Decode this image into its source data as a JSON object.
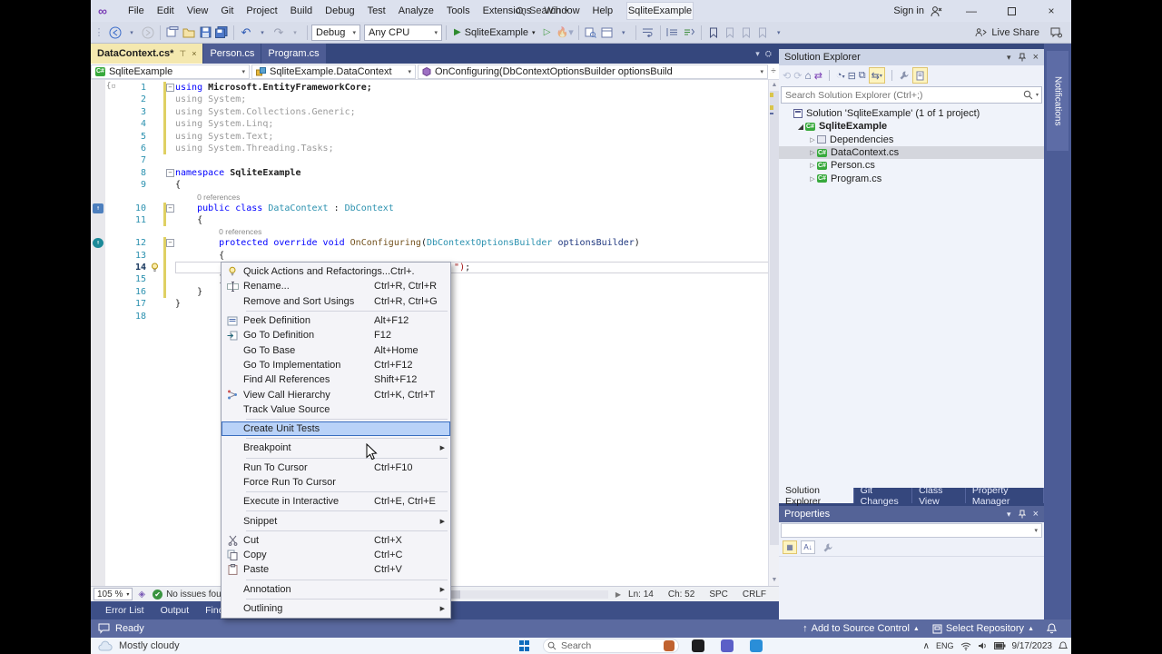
{
  "window": {
    "title_pill": "SqliteExample",
    "sign_in": "Sign in",
    "live_share": "Live Share"
  },
  "menubar": {
    "items": [
      "File",
      "Edit",
      "View",
      "Git",
      "Project",
      "Build",
      "Debug",
      "Test",
      "Analyze",
      "Tools",
      "Extensions",
      "Window",
      "Help"
    ],
    "search_label": "Search"
  },
  "toolbar": {
    "debug_config": "Debug",
    "platform": "Any CPU",
    "run_target": "SqliteExample"
  },
  "doc_tabs": [
    {
      "label": "DataContext.cs*",
      "active": true
    },
    {
      "label": "Person.cs",
      "active": false
    },
    {
      "label": "Program.cs",
      "active": false
    }
  ],
  "navbar": {
    "project": "SqliteExample",
    "type": "SqliteExample.DataContext",
    "member": "OnConfiguring(DbContextOptionsBuilder optionsBuild"
  },
  "editor": {
    "codelens_text": "0 references",
    "lines": [
      {
        "n": 1,
        "bar": true,
        "fold": true,
        "segs": [
          [
            "kw",
            "using"
          ],
          [
            "bd",
            " Microsoft.EntityFrameworkCore;"
          ]
        ]
      },
      {
        "n": 2,
        "bar": true,
        "segs": [
          [
            "gr",
            "using System;"
          ]
        ]
      },
      {
        "n": 3,
        "bar": true,
        "segs": [
          [
            "gr",
            "using System.Collections.Generic;"
          ]
        ]
      },
      {
        "n": 4,
        "bar": true,
        "segs": [
          [
            "gr",
            "using System.Linq;"
          ]
        ]
      },
      {
        "n": 5,
        "bar": true,
        "segs": [
          [
            "gr",
            "using System.Text;"
          ]
        ]
      },
      {
        "n": 6,
        "bar": true,
        "segs": [
          [
            "gr",
            "using System.Threading.Tasks;"
          ]
        ]
      },
      {
        "n": 7,
        "segs": []
      },
      {
        "n": 8,
        "fold": true,
        "segs": [
          [
            "kw",
            "namespace"
          ],
          [
            "bd",
            " SqliteExample"
          ]
        ]
      },
      {
        "n": 9,
        "segs": [
          [
            "pl",
            "{"
          ]
        ]
      },
      {
        "n": 10,
        "lens": true,
        "lenspad": 4,
        "bar": true,
        "fold": true,
        "micon": "cls",
        "segs": [
          [
            "kw",
            "    public class"
          ],
          [
            "ty",
            " DataContext"
          ],
          [
            "pl",
            " : "
          ],
          [
            "ty",
            "DbContext"
          ]
        ]
      },
      {
        "n": 11,
        "bar": true,
        "segs": [
          [
            "pl",
            "    {"
          ]
        ]
      },
      {
        "n": 12,
        "lens": true,
        "lenspad": 8,
        "bar": true,
        "fold": true,
        "micon": "mth",
        "segs": [
          [
            "kw",
            "        protected override void"
          ],
          [
            "me",
            " OnConfiguring"
          ],
          [
            "pl",
            "("
          ],
          [
            "ty",
            "DbContextOptionsBuilder"
          ],
          [
            "pa",
            " optionsBuilder"
          ],
          [
            "pl",
            ")"
          ]
        ]
      },
      {
        "n": 13,
        "bar": true,
        "segs": [
          [
            "pl",
            "        {"
          ]
        ]
      },
      {
        "n": 14,
        "bar": true,
        "caret": true,
        "bulb": true,
        "segs": [
          [
            "pl",
            "                                                   "
          ],
          [
            "st",
            "\")"
          ],
          [
            "pl",
            ";"
          ]
        ]
      },
      {
        "n": 15,
        "bar": true,
        "segs": [
          [
            "pl",
            "        }"
          ]
        ]
      },
      {
        "n": 16,
        "bar": true,
        "segs": [
          [
            "pl",
            "    }"
          ]
        ]
      },
      {
        "n": 17,
        "segs": [
          [
            "pl",
            "}"
          ]
        ]
      },
      {
        "n": 18,
        "segs": []
      }
    ]
  },
  "context_menu": {
    "items": [
      {
        "icon": "bulb",
        "label": "Quick Actions and Refactorings...",
        "shortcut": "Ctrl+."
      },
      {
        "icon": "rename",
        "label": "Rename...",
        "shortcut": "Ctrl+R, Ctrl+R"
      },
      {
        "label": "Remove and Sort Usings",
        "shortcut": "Ctrl+R, Ctrl+G",
        "sep": true
      },
      {
        "icon": "peek",
        "label": "Peek Definition",
        "shortcut": "Alt+F12"
      },
      {
        "icon": "goto",
        "label": "Go To Definition",
        "shortcut": "F12"
      },
      {
        "label": "Go To Base",
        "shortcut": "Alt+Home"
      },
      {
        "label": "Go To Implementation",
        "shortcut": "Ctrl+F12"
      },
      {
        "label": "Find All References",
        "shortcut": "Shift+F12"
      },
      {
        "icon": "hier",
        "label": "View Call Hierarchy",
        "shortcut": "Ctrl+K, Ctrl+T"
      },
      {
        "label": "Track Value Source",
        "sep": true
      },
      {
        "label": "Create Unit Tests",
        "highlighted": true,
        "sep": true
      },
      {
        "label": "Breakpoint",
        "submenu": true,
        "sep": true
      },
      {
        "label": "Run To Cursor",
        "shortcut": "Ctrl+F10"
      },
      {
        "label": "Force Run To Cursor",
        "sep": true
      },
      {
        "label": "Execute in Interactive",
        "shortcut": "Ctrl+E, Ctrl+E",
        "sep": true
      },
      {
        "label": "Snippet",
        "submenu": true,
        "sep": true
      },
      {
        "icon": "cut",
        "label": "Cut",
        "shortcut": "Ctrl+X"
      },
      {
        "icon": "copy",
        "label": "Copy",
        "shortcut": "Ctrl+C"
      },
      {
        "icon": "paste",
        "label": "Paste",
        "shortcut": "Ctrl+V",
        "sep": true
      },
      {
        "label": "Annotation",
        "submenu": true,
        "sep": true
      },
      {
        "label": "Outlining",
        "submenu": true
      }
    ]
  },
  "solution_explorer": {
    "title": "Solution Explorer",
    "search_placeholder": "Search Solution Explorer (Ctrl+;)",
    "tree": [
      {
        "icon": "sol",
        "label": "Solution 'SqliteExample' (1 of 1 project)",
        "indent": 0
      },
      {
        "icon": "proj",
        "label": "SqliteExample",
        "indent": 1,
        "arrow": "open",
        "bold": true
      },
      {
        "icon": "dep",
        "label": "Dependencies",
        "indent": 2,
        "arrow": "closed"
      },
      {
        "icon": "cs",
        "label": "DataContext.cs",
        "indent": 2,
        "arrow": "closed",
        "selected": true
      },
      {
        "icon": "cs",
        "label": "Person.cs",
        "indent": 2,
        "arrow": "closed"
      },
      {
        "icon": "cs",
        "label": "Program.cs",
        "indent": 2,
        "arrow": "closed"
      }
    ]
  },
  "panel_tabs": [
    {
      "label": "Solution Explorer",
      "active": true
    },
    {
      "label": "Git Changes",
      "active": false
    },
    {
      "label": "Class View",
      "active": false
    },
    {
      "label": "Property Manager",
      "active": false
    }
  ],
  "properties": {
    "title": "Properties"
  },
  "notifications_tab": "Notifications",
  "bottom_tabs": [
    "Error List",
    "Output",
    "Find Symbol Results"
  ],
  "editor_status": {
    "zoom": "105 %",
    "issues": "No issues found",
    "line": "Ln: 14",
    "column": "Ch: 52",
    "spaces": "SPC",
    "eol": "CRLF"
  },
  "status_bar": {
    "ready": "Ready",
    "add_to_source_control": "Add to Source Control",
    "select_repository": "Select Repository"
  },
  "taskbar": {
    "weather": "Mostly cloudy",
    "search_placeholder": "Search",
    "language": "ENG",
    "date": "9/17/2023"
  }
}
